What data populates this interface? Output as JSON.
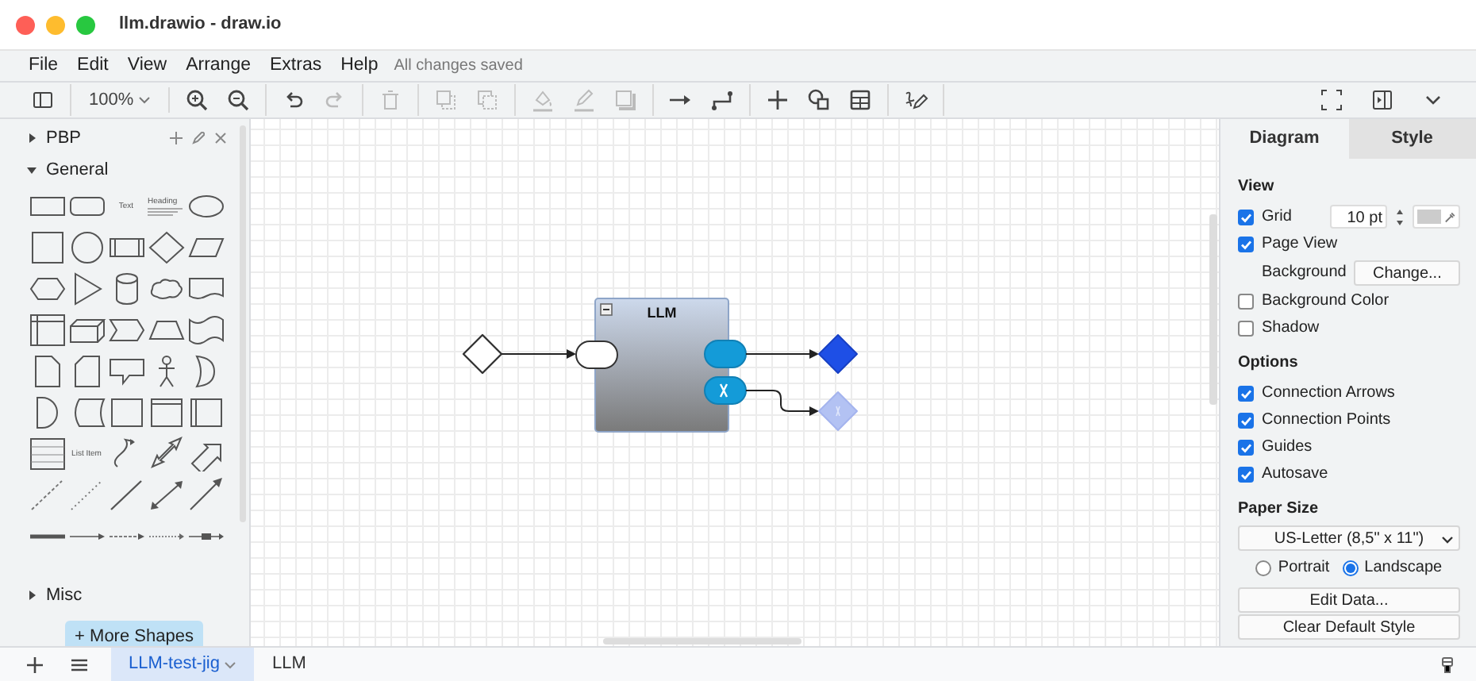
{
  "window": {
    "title": "llm.drawio - draw.io"
  },
  "menu": {
    "items": [
      "File",
      "Edit",
      "View",
      "Arrange",
      "Extras",
      "Help"
    ],
    "status": "All changes saved"
  },
  "toolbar": {
    "groups": [
      [
        {
          "kind": "sidebar",
          "disabled": false
        }
      ],
      [
        {
          "kind": "zoom",
          "label": "100%",
          "disabled": false
        }
      ],
      [
        {
          "kind": "zoomin",
          "disabled": false
        },
        {
          "kind": "zoomout",
          "disabled": false
        }
      ],
      [
        {
          "kind": "undo",
          "disabled": false
        },
        {
          "kind": "redo",
          "disabled": true
        }
      ],
      [
        {
          "kind": "delete",
          "disabled": true
        }
      ],
      [
        {
          "kind": "tofront",
          "disabled": true
        },
        {
          "kind": "toback",
          "disabled": true
        }
      ],
      [
        {
          "kind": "fill",
          "disabled": true
        },
        {
          "kind": "linecolor",
          "disabled": true
        },
        {
          "kind": "shadow",
          "disabled": true
        }
      ],
      [
        {
          "kind": "connection",
          "disabled": false
        },
        {
          "kind": "waypoint",
          "disabled": false
        }
      ],
      [
        {
          "kind": "insert",
          "disabled": false
        },
        {
          "kind": "shapes",
          "disabled": false
        },
        {
          "kind": "table",
          "disabled": false
        }
      ],
      [
        {
          "kind": "freehand",
          "disabled": false
        }
      ]
    ],
    "right": [
      {
        "kind": "fullscreen",
        "disabled": false
      },
      {
        "kind": "format",
        "disabled": false
      },
      {
        "kind": "chevron",
        "disabled": false
      }
    ]
  },
  "sidebar": {
    "sections": [
      {
        "title": "PBP",
        "expanded": false,
        "editable": true
      },
      {
        "title": "General",
        "expanded": true,
        "editable": false
      },
      {
        "title": "Misc",
        "expanded": false,
        "editable": false
      }
    ],
    "palette_texts": [
      "Text",
      "Heading",
      "List Item"
    ],
    "more_shapes": "+ More Shapes"
  },
  "diagram": {
    "container_title": "LLM",
    "outputs": [
      {
        "disabled": false
      },
      {
        "disabled": true
      }
    ]
  },
  "format_panel": {
    "tabs": [
      {
        "label": "Diagram",
        "selected": true
      },
      {
        "label": "Style",
        "selected": false
      }
    ],
    "sections": [
      {
        "title": "View",
        "rows": [
          {
            "kind": "checkbox",
            "label": "Grid",
            "checked": true,
            "value": "10 pt"
          },
          {
            "kind": "checkbox",
            "label": "Page View",
            "checked": true
          },
          {
            "kind": "button",
            "label": "Background",
            "button": "Change..."
          },
          {
            "kind": "checkbox",
            "label": "Background Color",
            "checked": false
          },
          {
            "kind": "checkbox",
            "label": "Shadow",
            "checked": false
          }
        ]
      },
      {
        "title": "Options",
        "rows": [
          {
            "kind": "checkbox",
            "label": "Connection Arrows",
            "checked": true
          },
          {
            "kind": "checkbox",
            "label": "Connection Points",
            "checked": true
          },
          {
            "kind": "checkbox",
            "label": "Guides",
            "checked": true
          },
          {
            "kind": "checkbox",
            "label": "Autosave",
            "checked": true
          }
        ]
      }
    ],
    "paper": {
      "title": "Paper Size",
      "select": "US-Letter (8,5\" x 11\")",
      "orientation": [
        {
          "label": "Portrait",
          "selected": false
        },
        {
          "label": "Landscape",
          "selected": true
        }
      ]
    },
    "buttons": [
      "Edit Data...",
      "Clear Default Style"
    ]
  },
  "footer": {
    "pages": [
      {
        "label": "LLM-test-jig",
        "selected": true
      },
      {
        "label": "LLM",
        "selected": false
      }
    ]
  }
}
